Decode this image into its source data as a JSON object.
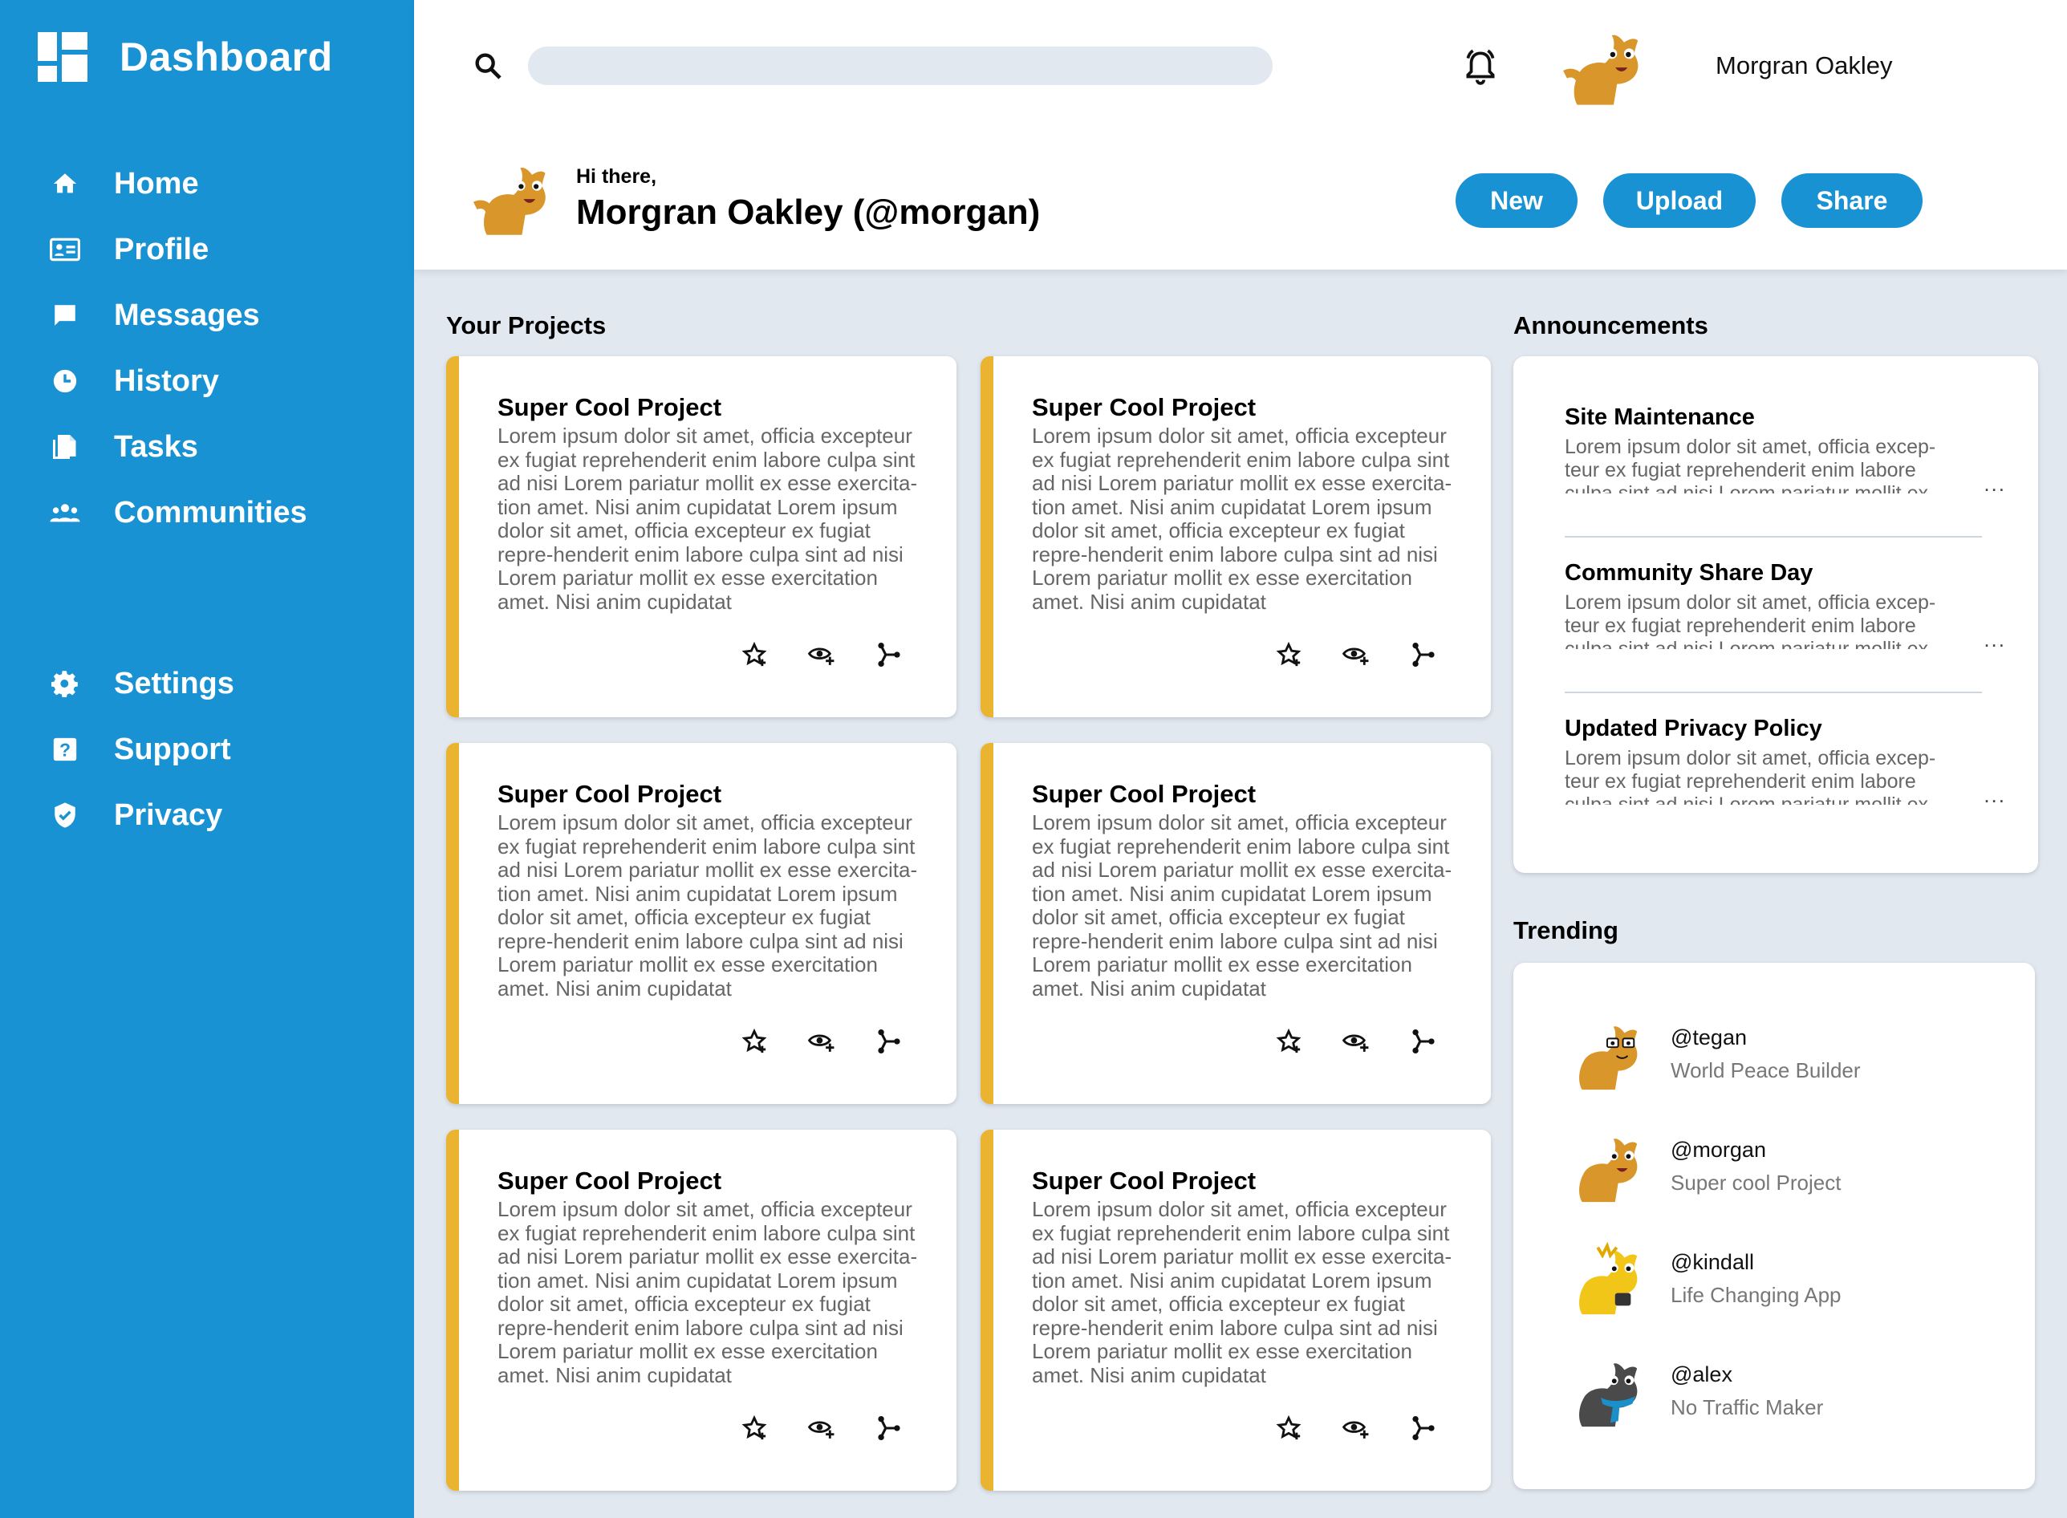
{
  "sidebar": {
    "title": "Dashboard",
    "nav": [
      {
        "label": "Home",
        "icon": "home-icon"
      },
      {
        "label": "Profile",
        "icon": "profile-card-icon"
      },
      {
        "label": "Messages",
        "icon": "message-icon"
      },
      {
        "label": "History",
        "icon": "clock-icon"
      },
      {
        "label": "Tasks",
        "icon": "document-icon"
      },
      {
        "label": "Communities",
        "icon": "people-icon"
      }
    ],
    "nav_bottom": [
      {
        "label": "Settings",
        "icon": "gear-icon"
      },
      {
        "label": "Support",
        "icon": "help-icon"
      },
      {
        "label": "Privacy",
        "icon": "shield-icon"
      }
    ]
  },
  "header": {
    "search": {
      "value": "",
      "placeholder": ""
    },
    "user_name": "Morgran Oakley",
    "greeting": "Hi there,",
    "greeting_name": "Morgran Oakley (@morgan)",
    "buttons": {
      "new": "New",
      "upload": "Upload",
      "share": "Share"
    }
  },
  "projects": {
    "title": "Your Projects",
    "items": [
      {
        "title": "Super Cool Project",
        "text": "Lorem ipsum dolor sit amet, officia excepteur ex fugiat reprehenderit enim labore culpa sint ad nisi Lorem pariatur mollit ex esse exercita-tion amet. Nisi anim cupidatat Lorem ipsum dolor sit amet, officia excepteur ex fugiat repre-henderit enim labore culpa sint ad nisi Lorem pariatur mollit ex esse exercitation amet. Nisi anim cupidatat"
      },
      {
        "title": "Super Cool Project",
        "text": "Lorem ipsum dolor sit amet, officia excepteur ex fugiat reprehenderit enim labore culpa sint ad nisi Lorem pariatur mollit ex esse exercita-tion amet. Nisi anim cupidatat Lorem ipsum dolor sit amet, officia excepteur ex fugiat repre-henderit enim labore culpa sint ad nisi Lorem pariatur mollit ex esse exercitation amet. Nisi anim cupidatat"
      },
      {
        "title": "Super Cool Project",
        "text": "Lorem ipsum dolor sit amet, officia excepteur ex fugiat reprehenderit enim labore culpa sint ad nisi Lorem pariatur mollit ex esse exercita-tion amet. Nisi anim cupidatat Lorem ipsum dolor sit amet, officia excepteur ex fugiat repre-henderit enim labore culpa sint ad nisi Lorem pariatur mollit ex esse exercitation amet. Nisi anim cupidatat"
      },
      {
        "title": "Super Cool Project",
        "text": "Lorem ipsum dolor sit amet, officia excepteur ex fugiat reprehenderit enim labore culpa sint ad nisi Lorem pariatur mollit ex esse exercita-tion amet. Nisi anim cupidatat Lorem ipsum dolor sit amet, officia excepteur ex fugiat repre-henderit enim labore culpa sint ad nisi Lorem pariatur mollit ex esse exercitation amet. Nisi anim cupidatat"
      },
      {
        "title": "Super Cool Project",
        "text": "Lorem ipsum dolor sit amet, officia excepteur ex fugiat reprehenderit enim labore culpa sint ad nisi Lorem pariatur mollit ex esse exercita-tion amet. Nisi anim cupidatat Lorem ipsum dolor sit amet, officia excepteur ex fugiat repre-henderit enim labore culpa sint ad nisi Lorem pariatur mollit ex esse exercitation amet. Nisi anim cupidatat"
      },
      {
        "title": "Super Cool Project",
        "text": "Lorem ipsum dolor sit amet, officia excepteur ex fugiat reprehenderit enim labore culpa sint ad nisi Lorem pariatur mollit ex esse exercita-tion amet. Nisi anim cupidatat Lorem ipsum dolor sit amet, officia excepteur ex fugiat repre-henderit enim labore culpa sint ad nisi Lorem pariatur mollit ex esse exercitation amet. Nisi anim cupidatat"
      }
    ]
  },
  "announcements": {
    "title": "Announcements",
    "more": "...",
    "items": [
      {
        "title": "Site Maintenance",
        "text": "Lorem ipsum dolor sit amet, officia excep-teur ex fugiat reprehenderit enim labore culpa sint ad nisi Lorem pariatur mollit ex esse exercitation amet."
      },
      {
        "title": "Community Share Day",
        "text": "Lorem ipsum dolor sit amet, officia excep-teur ex fugiat reprehenderit enim labore culpa sint ad nisi Lorem pariatur mollit ex esse exercitation amet."
      },
      {
        "title": "Updated Privacy Policy",
        "text": "Lorem ipsum dolor sit amet, officia excep-teur ex fugiat reprehenderit enim labore culpa sint ad nisi Lorem pariatur mollit ex esse exercitation amet."
      }
    ]
  },
  "trending": {
    "title": "Trending",
    "items": [
      {
        "handle": "@tegan",
        "desc": "World Peace Builder"
      },
      {
        "handle": "@morgan",
        "desc": "Super cool Project"
      },
      {
        "handle": "@kindall",
        "desc": "Life Changing App"
      },
      {
        "handle": "@alex",
        "desc": "No Traffic Maker"
      }
    ]
  },
  "colors": {
    "sidebar": "#1992d4",
    "accent": "#eab431",
    "background": "#e2e8f0",
    "button": "#1992d4"
  }
}
